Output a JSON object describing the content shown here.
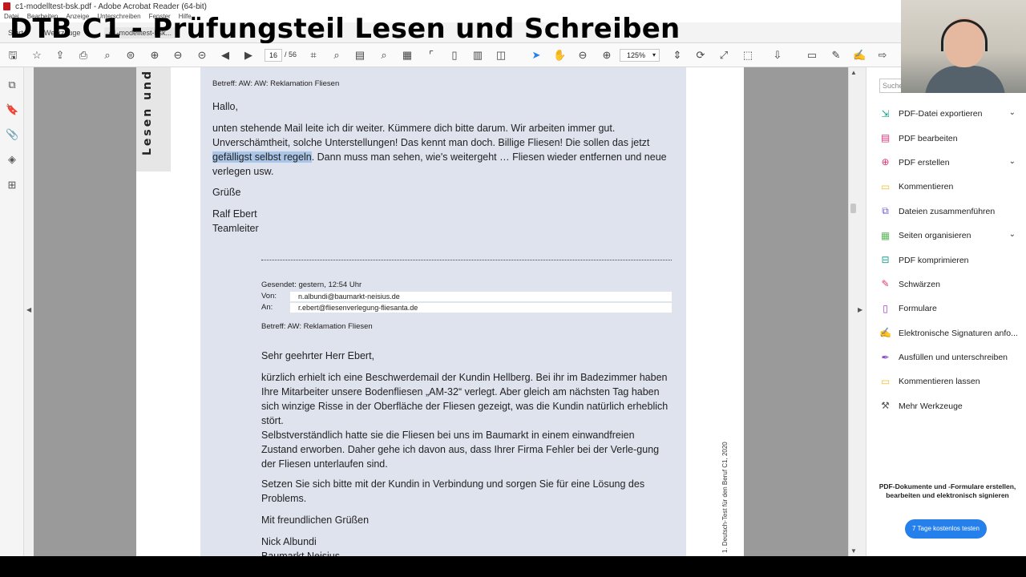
{
  "window": {
    "title": "c1-modelltest-bsk.pdf - Adobe Acrobat Reader (64-bit)",
    "menu": [
      "Datei",
      "Bearbeiten",
      "Anzeige",
      "Unterschreiben",
      "Fenster",
      "Hilfe"
    ]
  },
  "tabs": {
    "start": "Start",
    "tools": "Werkzeuge",
    "document": "c1-modelltest-bsk..."
  },
  "overlay_title": "DTB C1 - Prüfungsteil Lesen und Schreiben",
  "toolbar": {
    "page_current": "16",
    "page_total": "/ 56",
    "zoom": "125%"
  },
  "document": {
    "side_label": "Lesen und Sc",
    "footer_vertical": "1. Deutsch-Test für den Beruf C1, 2020",
    "mail1": {
      "subject": "Betreff: AW: AW: Reklamation Fliesen",
      "greeting": "Hallo,",
      "body_before_highlight": "unten stehende Mail leite ich dir weiter. Kümmere dich bitte darum. Wir arbeiten immer gut. Unverschämtheit, solche Unterstellungen! Das kennt man doch. Billige Fliesen! Die sollen das jetzt ",
      "highlight": "gefälligst selbst regeln",
      "body_after_highlight": ". Dann muss man sehen, wie's weitergeht … Fliesen wieder entfernen und neue verlegen usw.",
      "closing": "Grüße",
      "signature_name": "Ralf Ebert",
      "signature_role": "Teamleiter"
    },
    "mail2": {
      "sent": "Gesendet: gestern, 12:54 Uhr",
      "from_label": "Von:",
      "from_value": "n.albundi@baumarkt-neisius.de",
      "to_label": "An:",
      "to_value": "r.ebert@fliesenverlegung-fliesanta.de",
      "subject": "Betreff: AW: Reklamation Fliesen",
      "salutation": "Sehr geehrter Herr Ebert,",
      "paragraph1": "kürzlich erhielt ich eine Beschwerdemail der Kundin Hellberg. Bei ihr im Badezimmer haben Ihre Mitarbeiter unsere Bodenfliesen „AM-32“ verlegt. Aber gleich am nächsten Tag haben sich winzige Risse in der Oberfläche der Fliesen gezeigt, was die Kundin natürlich erheblich stört.",
      "paragraph2": "Selbstverständlich hatte sie die Fliesen bei uns im Baumarkt in einem einwandfreien Zustand erworben. Daher gehe ich davon aus, dass Ihrer Firma Fehler bei der Verle-gung der Fliesen unterlaufen sind.",
      "paragraph3": "Setzen Sie sich bitte mit der Kundin in Verbindung und sorgen Sie für eine Lösung des Problems.",
      "closing": "Mit freundlichen Grüßen",
      "signature_name": "Nick Albundi",
      "signature_company": "Baumarkt Neisius"
    }
  },
  "right_pane": {
    "search_placeholder": "Suche",
    "tools": [
      {
        "label": "PDF-Datei exportieren",
        "icon": "export-pdf-icon",
        "color": "#1aa08c",
        "chevron": true
      },
      {
        "label": "PDF bearbeiten",
        "icon": "edit-pdf-icon",
        "color": "#d9367b",
        "chevron": false
      },
      {
        "label": "PDF erstellen",
        "icon": "create-pdf-icon",
        "color": "#d9367b",
        "chevron": true
      },
      {
        "label": "Kommentieren",
        "icon": "comment-icon",
        "color": "#f2c12e",
        "chevron": false
      },
      {
        "label": "Dateien zusammenführen",
        "icon": "combine-files-icon",
        "color": "#6b5bd6",
        "chevron": false
      },
      {
        "label": "Seiten organisieren",
        "icon": "organize-pages-icon",
        "color": "#5cb85c",
        "chevron": true
      },
      {
        "label": "PDF komprimieren",
        "icon": "compress-pdf-icon",
        "color": "#1aa08c",
        "chevron": false
      },
      {
        "label": "Schwärzen",
        "icon": "redact-icon",
        "color": "#d9367b",
        "chevron": false
      },
      {
        "label": "Formulare",
        "icon": "forms-icon",
        "color": "#a23bcb",
        "chevron": false
      },
      {
        "label": "Elektronische Signaturen anfo...",
        "icon": "e-signature-icon",
        "color": "#a23bcb",
        "chevron": false
      },
      {
        "label": "Ausfüllen und unterschreiben",
        "icon": "fill-sign-icon",
        "color": "#8a4fd1",
        "chevron": false
      },
      {
        "label": "Kommentieren lassen",
        "icon": "send-comments-icon",
        "color": "#f2c12e",
        "chevron": false
      },
      {
        "label": "Mehr Werkzeuge",
        "icon": "more-tools-icon",
        "color": "#555555",
        "chevron": false
      }
    ],
    "promo_text": "PDF-Dokumente und -Formulare erstellen, bearbeiten und elektronisch signieren",
    "trial_button": "7 Tage kostenlos testen"
  }
}
